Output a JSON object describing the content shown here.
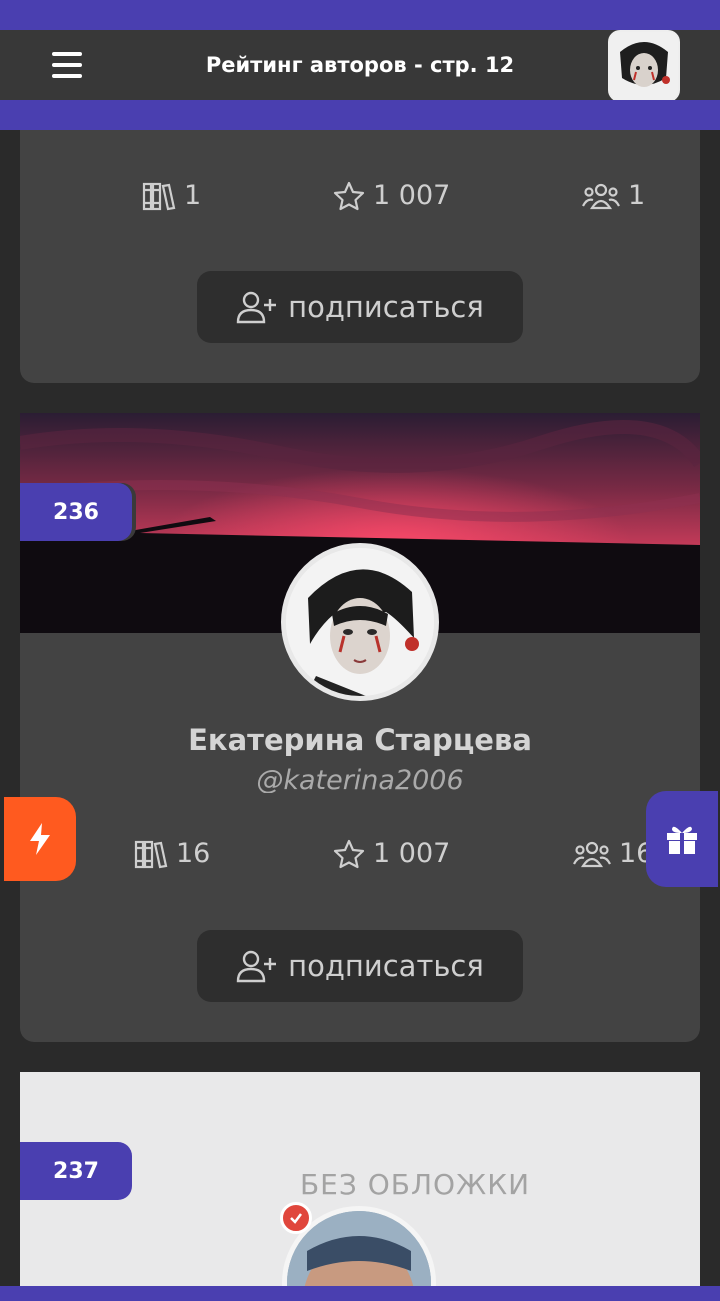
{
  "header": {
    "title": "Рейтинг авторов - стр. 12"
  },
  "cards": [
    {
      "stats": {
        "books": "1",
        "rating": "1 007",
        "followers": "1"
      },
      "subscribe_label": "подписаться"
    },
    {
      "rank": "236",
      "name": "Екатерина Старцева",
      "handle": "@katerina2006",
      "stats": {
        "books": "16",
        "rating": "1 007",
        "followers": "16"
      },
      "subscribe_label": "подписаться"
    },
    {
      "rank": "237",
      "no_cover_label": "БЕЗ ОБЛОЖКИ"
    }
  ],
  "colors": {
    "accent": "#4a3fb0",
    "bolt": "#ff5a1f",
    "card_bg": "#434343"
  },
  "icons": [
    "menu-icon",
    "books-icon",
    "star-icon",
    "users-icon",
    "user-plus-icon",
    "bolt-icon",
    "gift-icon",
    "verified-icon"
  ]
}
